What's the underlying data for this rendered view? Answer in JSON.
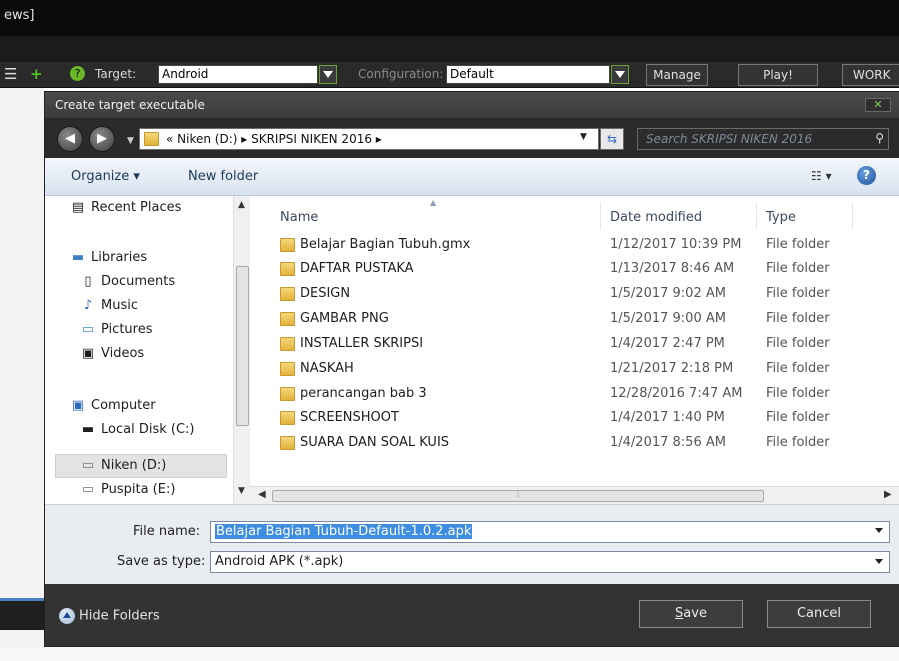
{
  "ide": {
    "window_title_fragment": "ews]",
    "toolbar": {
      "target_label": "Target:",
      "target_value": "Android",
      "config_label": "Configuration:",
      "config_value": "Default",
      "manage": "Manage",
      "play": "Play!",
      "work": "WORK"
    }
  },
  "dialog": {
    "title": "Create target executable",
    "close_glyph": "✕",
    "address": {
      "chevrons": "«",
      "path": "Niken (D:)  ▸  SKRIPSI NIKEN 2016  ▸"
    },
    "search": {
      "placeholder": "Search SKRIPSI NIKEN 2016"
    },
    "commands": {
      "organize": "Organize ▾",
      "new_folder": "New folder",
      "view": "☷ ▾",
      "help": "?"
    },
    "nav": {
      "items": [
        {
          "label": "Recent Places",
          "icon": "recent-places-icon"
        },
        {
          "label": "Libraries",
          "icon": "libraries-icon"
        },
        {
          "label": "Documents",
          "icon": "documents-icon"
        },
        {
          "label": "Music",
          "icon": "music-icon"
        },
        {
          "label": "Pictures",
          "icon": "pictures-icon"
        },
        {
          "label": "Videos",
          "icon": "videos-icon"
        },
        {
          "label": "Computer",
          "icon": "computer-icon"
        },
        {
          "label": "Local Disk (C:)",
          "icon": "local-disk-icon"
        },
        {
          "label": "Niken (D:)",
          "icon": "drive-icon"
        },
        {
          "label": "Puspita (E:)",
          "icon": "drive-icon"
        }
      ]
    },
    "columns": {
      "name": "Name",
      "date": "Date modified",
      "type": "Type"
    },
    "files": [
      {
        "name": "Belajar Bagian Tubuh.gmx",
        "date": "1/12/2017 10:39 PM",
        "type": "File folder"
      },
      {
        "name": "DAFTAR PUSTAKA",
        "date": "1/13/2017 8:46 AM",
        "type": "File folder"
      },
      {
        "name": "DESIGN",
        "date": "1/5/2017 9:02 AM",
        "type": "File folder"
      },
      {
        "name": "GAMBAR PNG",
        "date": "1/5/2017 9:00 AM",
        "type": "File folder"
      },
      {
        "name": "INSTALLER SKRIPSI",
        "date": "1/4/2017 2:47 PM",
        "type": "File folder"
      },
      {
        "name": "NASKAH",
        "date": "1/21/2017 2:18 PM",
        "type": "File folder"
      },
      {
        "name": "perancangan bab 3",
        "date": "12/28/2016 7:47 AM",
        "type": "File folder"
      },
      {
        "name": "SCREENSHOOT",
        "date": "1/4/2017 1:40 PM",
        "type": "File folder"
      },
      {
        "name": "SUARA DAN SOAL KUIS",
        "date": "1/4/2017 8:56 AM",
        "type": "File folder"
      }
    ],
    "form": {
      "file_name_label": "File name:",
      "file_name_value": "Belajar Bagian Tubuh-Default-1.0.2.apk",
      "save_type_label": "Save as type:",
      "save_type_value": "Android APK  (*.apk)"
    },
    "footer": {
      "hide_folders": "Hide Folders",
      "save_first": "S",
      "save_rest": "ave",
      "cancel": "Cancel"
    }
  }
}
